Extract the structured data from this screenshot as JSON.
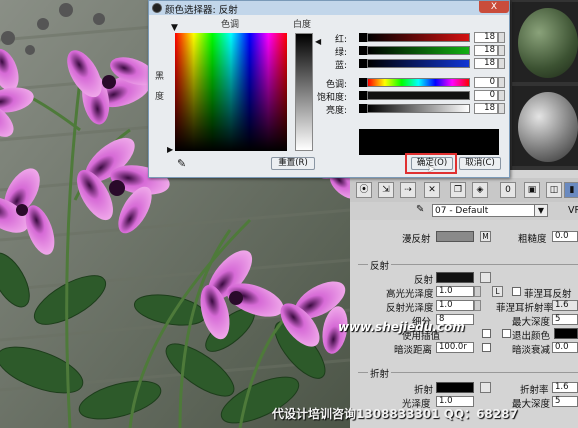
{
  "color_dialog": {
    "title": "颜色选择器: 反射",
    "close_label": "X",
    "hue_label": "色调",
    "whiteness_label": "白度",
    "blackness_label": "黑度",
    "sliders": [
      {
        "label": "红:",
        "value": "18",
        "color": "#c01010"
      },
      {
        "label": "绿:",
        "value": "18",
        "color": "#10a010"
      },
      {
        "label": "蓝:",
        "value": "18",
        "color": "#1030c0"
      },
      {
        "label": "色调:",
        "value": "0",
        "color": "rainbow"
      },
      {
        "label": "饱和度:",
        "value": "0",
        "color": "#000000"
      },
      {
        "label": "亮度:",
        "value": "18",
        "color": "#000000"
      }
    ],
    "reset_label": "重置(R)",
    "ok_label": "确定(O)",
    "cancel_label": "取消(C)",
    "current_color": "#121212"
  },
  "material_editor": {
    "material_name": "07 - Default",
    "side_label": "VR",
    "diffuse": {
      "label": "漫反射",
      "map_button": "M",
      "roughness_label": "粗糙度",
      "roughness_value": "0.0"
    },
    "reflection_group": {
      "title": "反射",
      "reflect_label": "反射",
      "hilight_gloss_label": "高光光泽度",
      "hilight_gloss_value": "1.0",
      "lock_label": "L",
      "fresnel_label": "菲涅耳反射",
      "refl_gloss_label": "反射光泽度",
      "refl_gloss_value": "1.0",
      "fresnel_ior_label": "菲涅耳折射率",
      "fresnel_ior_value": "1.6",
      "subdivs_label": "细分",
      "subdivs_value": "8",
      "max_depth_label": "最大深度",
      "max_depth_value": "5",
      "use_interp_label": "使用插值",
      "exit_color_label": "退出颜色",
      "dim_distance_label": "暗淡距离",
      "dim_distance_value": "100.0r",
      "dim_falloff_label": "暗淡衰减",
      "dim_falloff_value": "0.0"
    },
    "refraction_group": {
      "title": "折射",
      "refract_label": "折射",
      "ior_label": "折射率",
      "ior_value": "1.6",
      "gloss_label": "光泽度",
      "gloss_value": "1.0",
      "max_depth_label": "最大深度",
      "max_depth_value": "5"
    }
  },
  "watermarks": {
    "site": "www.shejiedu.com",
    "footer": "代设计培训咨询1308833301 QQ：68287"
  }
}
